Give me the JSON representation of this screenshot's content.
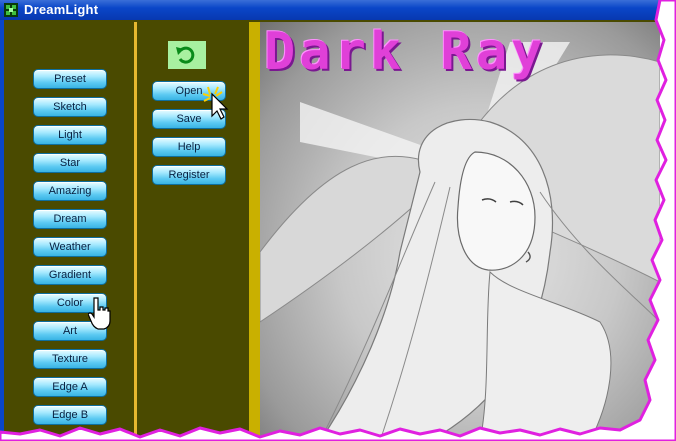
{
  "window": {
    "title": "DreamLight"
  },
  "effects_panel": {
    "buttons": [
      "Preset",
      "Sketch",
      "Light",
      "Star",
      "Amazing",
      "Dream",
      "Weather",
      "Gradient",
      "Color",
      "Art",
      "Texture",
      "Edge A",
      "Edge B"
    ]
  },
  "file_panel": {
    "buttons": [
      "Open",
      "Save",
      "Help",
      "Register"
    ]
  },
  "image": {
    "title_text": "Dark Ray"
  },
  "icons": [
    "app-icon",
    "undo-icon",
    "pointer-cursor",
    "hand-cursor"
  ]
}
